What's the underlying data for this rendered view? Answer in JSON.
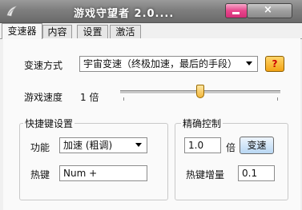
{
  "window": {
    "title": "游戏守望者 2.0....",
    "close_glyph": "×"
  },
  "tabs": [
    {
      "label": "变速器",
      "active": true
    },
    {
      "label": "内容",
      "active": false
    },
    {
      "label": "设置",
      "active": false
    },
    {
      "label": "激活",
      "active": false
    }
  ],
  "speed_mode": {
    "label": "变速方式",
    "selected": "宇宙变速（终极加速，最后的手段）",
    "help_label": "?"
  },
  "game_speed": {
    "label": "游戏速度",
    "value_text": "1 倍",
    "slider_fraction": 0.5
  },
  "hotkey_settings": {
    "title": "快捷键设置",
    "function_label": "功能",
    "function_selected": "加速 (粗调)",
    "hotkey_label": "热键",
    "hotkey_value": "Num +"
  },
  "precise_control": {
    "title": "精确控制",
    "multiplier_value": "1.0",
    "multiplier_unit": "倍",
    "apply_label": "变速",
    "increment_label": "热键增量",
    "increment_value": "0.1"
  },
  "colors": {
    "titlebar": "#7e7e7e",
    "minimize": "#e7468c",
    "help": "#f3a315",
    "button": "#b8d7f3"
  }
}
